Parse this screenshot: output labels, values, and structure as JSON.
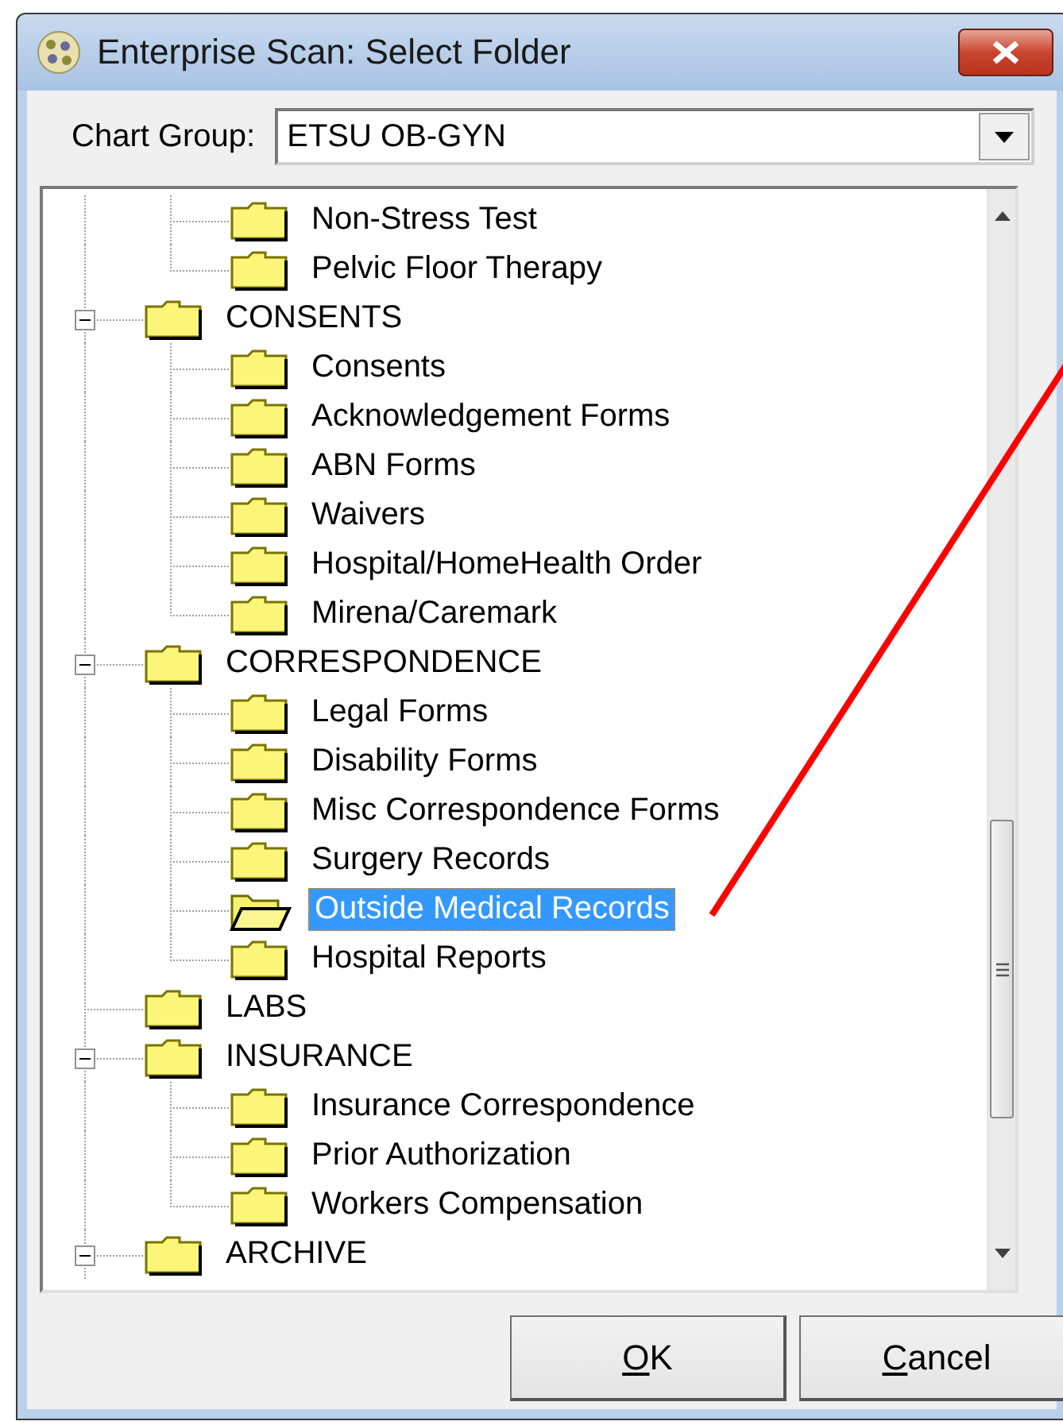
{
  "window": {
    "title": "Enterprise Scan: Select Folder"
  },
  "chart_group": {
    "label": "Chart Group:",
    "value": "ETSU OB-GYN"
  },
  "tree": {
    "continued_children": [
      {
        "label": "Non-Stress Test",
        "selected": false
      },
      {
        "label": "Pelvic Floor Therapy",
        "selected": false
      }
    ],
    "items": [
      {
        "label": "CONSENTS",
        "expanded": true,
        "selected": false,
        "children": [
          {
            "label": "Consents",
            "selected": false
          },
          {
            "label": "Acknowledgement Forms",
            "selected": false
          },
          {
            "label": "ABN Forms",
            "selected": false
          },
          {
            "label": "Waivers",
            "selected": false
          },
          {
            "label": "Hospital/HomeHealth Order",
            "selected": false
          },
          {
            "label": "Mirena/Caremark",
            "selected": false
          }
        ]
      },
      {
        "label": "CORRESPONDENCE",
        "expanded": true,
        "selected": false,
        "children": [
          {
            "label": "Legal Forms",
            "selected": false
          },
          {
            "label": "Disability Forms",
            "selected": false
          },
          {
            "label": "Misc Correspondence Forms",
            "selected": false
          },
          {
            "label": "Surgery Records",
            "selected": false
          },
          {
            "label": "Outside Medical Records",
            "selected": true
          },
          {
            "label": "Hospital Reports",
            "selected": false
          }
        ]
      },
      {
        "label": "LABS",
        "selected": false
      },
      {
        "label": "INSURANCE",
        "expanded": true,
        "selected": false,
        "children": [
          {
            "label": "Insurance Correspondence",
            "selected": false
          },
          {
            "label": "Prior Authorization",
            "selected": false
          },
          {
            "label": "Workers Compensation",
            "selected": false
          }
        ]
      },
      {
        "label": "ARCHIVE",
        "expanded": true,
        "selected": false
      }
    ]
  },
  "buttons": [
    {
      "label": "OK"
    },
    {
      "label": "Cancel"
    }
  ]
}
